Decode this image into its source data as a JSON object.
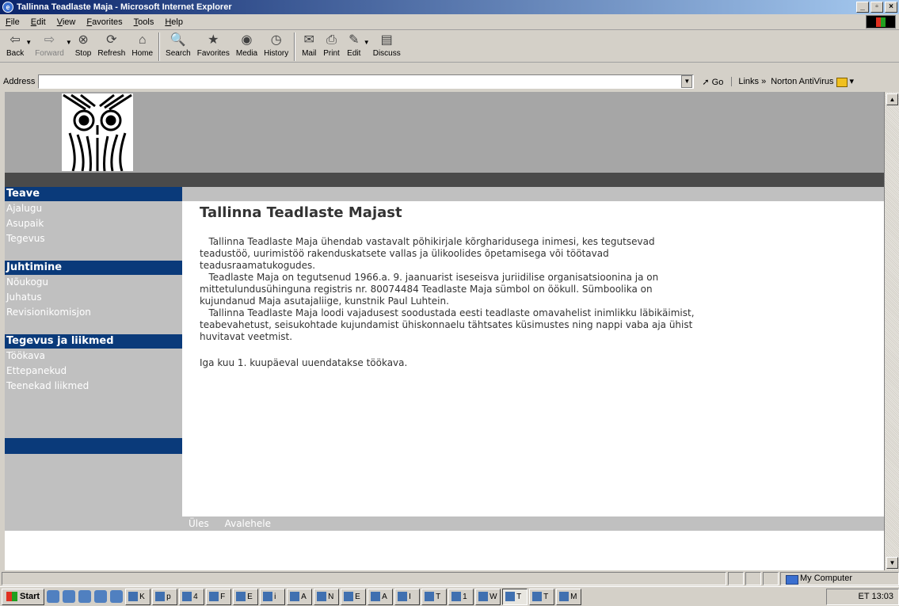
{
  "window": {
    "title": "Tallinna Teadlaste Maja - Microsoft Internet Explorer"
  },
  "menu": [
    "File",
    "Edit",
    "View",
    "Favorites",
    "Tools",
    "Help"
  ],
  "toolbar": {
    "back": "Back",
    "forward": "Forward",
    "stop": "Stop",
    "refresh": "Refresh",
    "home": "Home",
    "search": "Search",
    "favorites": "Favorites",
    "media": "Media",
    "history": "History",
    "mail": "Mail",
    "print": "Print",
    "edit": "Edit",
    "discuss": "Discuss"
  },
  "address": {
    "label": "Address",
    "value": "",
    "go": "Go",
    "links": "Links",
    "norton": "Norton AntiVirus"
  },
  "sidebar": {
    "sections": [
      {
        "title": "Teave",
        "items": [
          "Ajalugu",
          "Asupaik",
          "Tegevus"
        ]
      },
      {
        "title": "Juhtimine",
        "items": [
          "Nõukogu",
          "Juhatus",
          "Revisionikomisjon"
        ]
      },
      {
        "title": "Tegevus ja liikmed",
        "items": [
          "Töökava",
          "Ettepanekud",
          "Teenekad liikmed"
        ]
      }
    ]
  },
  "main": {
    "heading": "Tallinna Teadlaste Majast",
    "paragraph": "   Tallinna Teadlaste Maja ühendab vastavalt põhikirjale kõrgharidusega inimesi, kes tegutsevad\nteadustöö, uurimistöö rakenduskatsete vallas ja ülikoolides õpetamisega või töötavad\nteadusraamatukogudes.\n   Teadlaste Maja on tegutsenud 1966.a. 9. jaanuarist iseseisva juriidilise organisatsioonina ja on\nmittetulundusühinguna registris nr. 80074484 Teadlaste Maja sümbol on öökull. Sümboolika on\nkujundanud Maja asutajaliige, kunstnik Paul Luhtein.\n   Tallinna Teadlaste Maja loodi vajadusest soodustada eesti teadlaste omavahelist inimlikku läbikäimist,\nteabevahetust, seisukohtade kujundamist ühiskonnaelu tähtsates küsimustes ning nappi vaba aja ühist\nhuvitavat veetmist.",
    "note": "Iga kuu 1. kuupäeval uuendatakse töökava."
  },
  "footer": {
    "up": "Üles",
    "home": "Avalehele"
  },
  "status": {
    "zone": "My Computer"
  },
  "taskbar": {
    "start": "Start",
    "tasks": [
      "K",
      "p",
      "4",
      "F",
      "E",
      "i",
      "A",
      "N",
      "E",
      "A",
      "I",
      "T",
      "1",
      "W",
      "T",
      "T",
      "M"
    ],
    "clock": "13:03",
    "lang": "ET"
  },
  "colors": {
    "nav_head": "#0a3a7a",
    "banner": "#a6a6a6",
    "sidebar": "#c0c0c0",
    "titlebar": "#0a246a"
  }
}
